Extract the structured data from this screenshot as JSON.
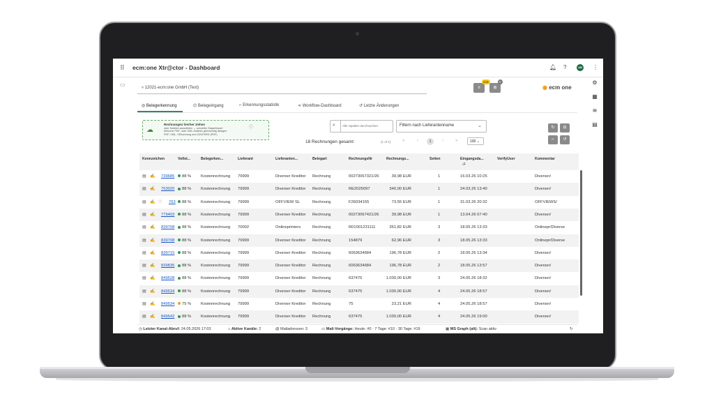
{
  "app": {
    "title": "ecm:one Xtr@ctor - Dashboard",
    "avatar": "AB"
  },
  "header": {
    "tenant": "12021-ecm:one GmbH (Test)",
    "badge_1": "215",
    "badge_2": "0",
    "logo_text": "ecm one",
    "logo_accent": "#f39c12"
  },
  "tabs": [
    {
      "label": "Belegerkennung",
      "active": true
    },
    {
      "label": "Belegeingang"
    },
    {
      "label": "Erkennungsstatistik"
    },
    {
      "label": "Workflow-Dashboard"
    },
    {
      "label": "Letzte Änderungen"
    }
  ],
  "upload": {
    "title": "Rechnungen hierher ziehen",
    "subtitle": "oder Dateien auswählen → schneller Stapelimport",
    "hint": "Mehrere PDF- oder XML-Dateien gleichzeitig ablegen",
    "formats": "PDF, XML, XRechnung und ZUGFeRD (PDF)"
  },
  "search": {
    "placeholder": "Alle Spalten durchsuchen"
  },
  "filter": {
    "label": "Filtern nach Lieferantenname"
  },
  "pagination": {
    "total": "18 Rechnungen gesamt",
    "page_info": "(1 of 1)",
    "current": "1",
    "page_size": "100"
  },
  "table": {
    "columns": [
      "Kennzeichen",
      "Vollst...",
      "Belegerken...",
      "Lieferant",
      "Lieferanten...",
      "Belegart",
      "RechnungsNr",
      "Rechnungs...",
      "Seiten",
      "Eingangsda...",
      "VerifyUser",
      "Kommentar"
    ],
    "rows": [
      {
        "id": "739685",
        "pct": "88 %",
        "type": "Kostenrechnung",
        "supplier": "79999",
        "supplier_name": "Diverser Kreditor",
        "doc": "Rechnung",
        "nr": "00273067321/26",
        "amount": "39,98 EUR",
        "pages": "1",
        "date": "16.03.26 10:25",
        "comment": "Diverser/"
      },
      {
        "id": "753020",
        "pct": "88 %",
        "type": "Kostenrechnung",
        "supplier": "79999",
        "supplier_name": "Diverser Kreditor",
        "doc": "Rechnung",
        "nr": "RE2025097",
        "amount": "340,00 EUR",
        "pages": "1",
        "date": "24.03.26 13:40",
        "comment": "Diverser/"
      },
      {
        "id": "763",
        "pct": "88 %",
        "type": "Kostenrechnung",
        "supplier": "79999",
        "supplier_name": "OFFVIEW SL",
        "doc": "Rechnung",
        "nr": "F26034155",
        "amount": "73,55 EUR",
        "pages": "1",
        "date": "31.03.26 20:32",
        "comment": "OFFVIEWS/",
        "heart": true
      },
      {
        "id": "779403",
        "pct": "88 %",
        "type": "Kostenrechnung",
        "supplier": "79999",
        "supplier_name": "Diverser Kreditor",
        "doc": "Rechnung",
        "nr": "00273067421/26",
        "amount": "39,98 EUR",
        "pages": "1",
        "date": "13.04.26 07:40",
        "comment": "Diverser/"
      },
      {
        "id": "839708",
        "pct": "88 %",
        "type": "Kostenrechnung",
        "supplier": "70002",
        "supplier_name": "Onlineprinters",
        "doc": "Rechnung",
        "nr": "R01001231111",
        "amount": "361,82 EUR",
        "pages": "3",
        "date": "18.05.26 13:33",
        "comment": "Onlinepr/Diverse"
      },
      {
        "id": "839708",
        "pct": "88 %",
        "type": "Kostenrechnung",
        "supplier": "79999",
        "supplier_name": "Diverser Kreditor",
        "doc": "Rechnung",
        "nr": "154879",
        "amount": "62,96 EUR",
        "pages": "3",
        "date": "18.05.26 13:33",
        "comment": "Onlinepr/Diverse"
      },
      {
        "id": "839715",
        "pct": "88 %",
        "type": "Kostenrechnung",
        "supplier": "79999",
        "supplier_name": "Diverser Kreditor",
        "doc": "Rechnung",
        "nr": "6063634684",
        "amount": "196,78 EUR",
        "pages": "2",
        "date": "18.05.26 13:34",
        "comment": "Diverser/"
      },
      {
        "id": "839835",
        "pct": "88 %",
        "type": "Kostenrechnung",
        "supplier": "79999",
        "supplier_name": "Diverser Kreditor",
        "doc": "Rechnung",
        "nr": "6063634684",
        "amount": "196,78 EUR",
        "pages": "2",
        "date": "18.05.26 13:57",
        "comment": "Diverser/"
      },
      {
        "id": "849528",
        "pct": "88 %",
        "type": "Kostenrechnung",
        "supplier": "79999",
        "supplier_name": "Diverser Kreditor",
        "doc": "Rechnung",
        "nr": "637475",
        "amount": "1.030,00 EUR",
        "pages": "3",
        "date": "24.05.26 18:32",
        "comment": "Diverser/"
      },
      {
        "id": "849534",
        "pct": "88 %",
        "type": "Kostenrechnung",
        "supplier": "79999",
        "supplier_name": "Diverser Kreditor",
        "doc": "Rechnung",
        "nr": "637475",
        "amount": "1.030,00 EUR",
        "pages": "4",
        "date": "24.05.26 18:57",
        "comment": "Diverser/"
      },
      {
        "id": "849534",
        "pct": "75 %",
        "type": "Kostenrechnung",
        "supplier": "79999",
        "supplier_name": "Diverser Kreditor",
        "doc": "Rechnung",
        "nr": "75",
        "amount": "23,21 EUR",
        "pages": "4",
        "date": "24.05.26 18:57",
        "comment": "Diverser/",
        "amber": true
      },
      {
        "id": "849542",
        "pct": "88 %",
        "type": "Kostenrechnung",
        "supplier": "79999",
        "supplier_name": "Diverser Kreditor",
        "doc": "Rechnung",
        "nr": "637475",
        "amount": "1.030,00 EUR",
        "pages": "4",
        "date": "24.05.26 19:00",
        "comment": "Diverser/"
      }
    ]
  },
  "status": {
    "last_fetch_label": "Letzter Kanal-Abruf:",
    "last_fetch_value": "24.05.2026 17:03",
    "channels_label": "Aktive Kanäle:",
    "channels_value": "2",
    "mail_label": "Mailadressen:",
    "mail_value": "3",
    "proc_label": "Mail-Vorgänge:",
    "proc_value": "Heute: #0 · 7 Tage: #10 · 30 Tage: #19",
    "graph_label": "MS Graph (alt):",
    "graph_value": "Scan aktiv"
  }
}
